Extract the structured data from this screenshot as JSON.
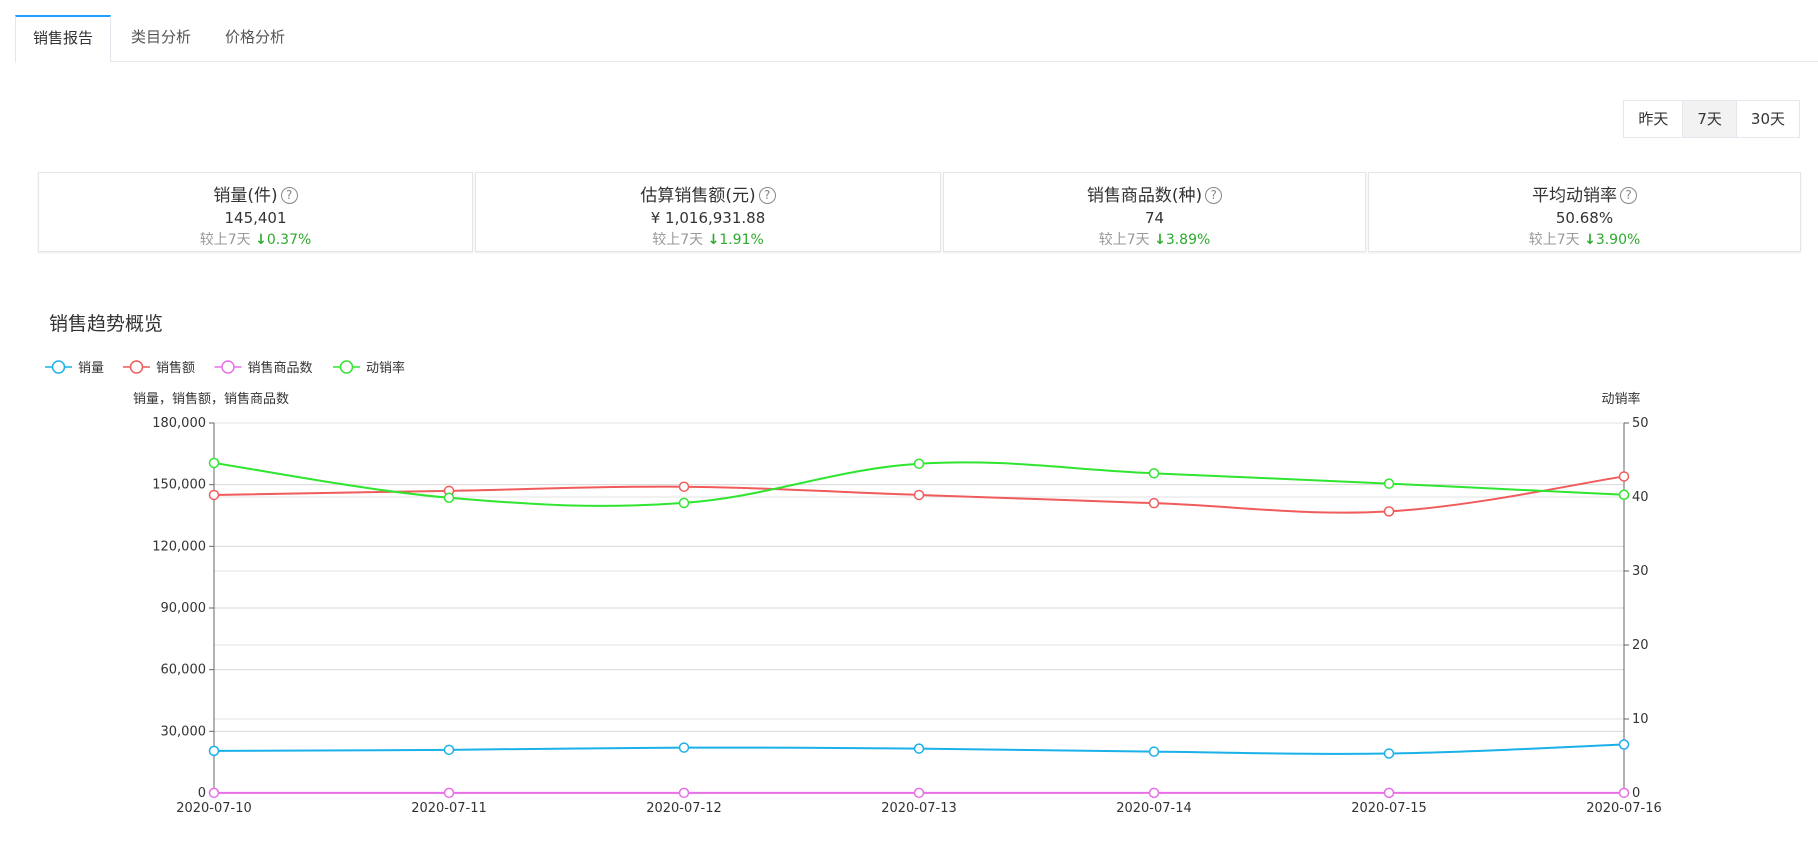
{
  "tabs": [
    "销售报告",
    "类目分析",
    "价格分析"
  ],
  "range_buttons": [
    "昨天",
    "7天",
    "30天"
  ],
  "cards": [
    {
      "title": "销量(件)",
      "value": "145,401",
      "compare_label": "较上7天",
      "delta": "0.37%"
    },
    {
      "title": "估算销售额(元)",
      "value": "¥ 1,016,931.88",
      "compare_label": "较上7天",
      "delta": "1.91%"
    },
    {
      "title": "销售商品数(种)",
      "value": "74",
      "compare_label": "较上7天",
      "delta": "3.89%"
    },
    {
      "title": "平均动销率",
      "value": "50.68%",
      "compare_label": "较上7天",
      "delta": "3.90%"
    }
  ],
  "section_title": "销售趋势概览",
  "icons": {
    "help": "question-circle-icon",
    "down": "arrow-down-icon"
  },
  "chart_data": {
    "type": "line",
    "x": [
      "2020-07-10",
      "2020-07-11",
      "2020-07-12",
      "2020-07-13",
      "2020-07-14",
      "2020-07-15",
      "2020-07-16"
    ],
    "left_axis": {
      "label": "销量，销售额，销售商品数",
      "ylim": [
        0,
        180000
      ],
      "ticks": [
        "0",
        "30,000",
        "60,000",
        "90,000",
        "120,000",
        "150,000",
        "180,000"
      ]
    },
    "right_axis": {
      "label": "动销率",
      "ylim": [
        0,
        50
      ],
      "ticks": [
        "0",
        "10",
        "20",
        "30",
        "40",
        "50"
      ]
    },
    "legend_position": "top-left",
    "grid": true,
    "series": [
      {
        "name": "销量",
        "axis": "left",
        "color": "#1ab0e8",
        "values": [
          20500,
          21000,
          22100,
          21600,
          20100,
          19200,
          23600
        ]
      },
      {
        "name": "销售额",
        "axis": "left",
        "color": "#f05b5b",
        "values": [
          145000,
          147000,
          149000,
          145000,
          141000,
          137000,
          154000
        ]
      },
      {
        "name": "销售商品数",
        "axis": "left",
        "color": "#e86fe8",
        "values": [
          74,
          73,
          75,
          74,
          72,
          71,
          74
        ]
      },
      {
        "name": "动销率",
        "axis": "right",
        "color": "#2fe52f",
        "values": [
          44.6,
          39.9,
          39.2,
          44.5,
          43.2,
          41.8,
          40.3
        ]
      }
    ]
  }
}
